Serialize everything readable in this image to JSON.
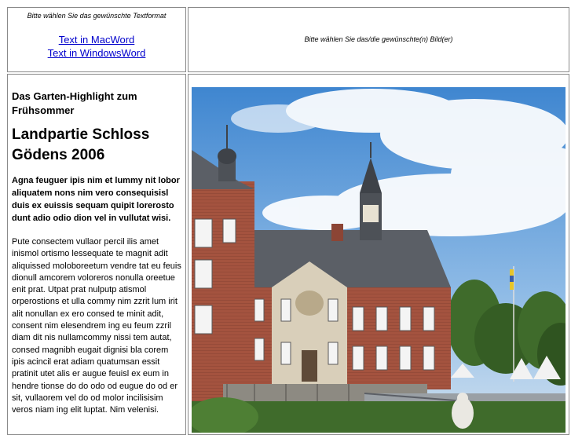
{
  "format_panel": {
    "prompt": "Bitte wählen Sie das gewünschte Textformat",
    "links": [
      "Text in MacWord",
      "Text in WindowsWord"
    ]
  },
  "image_panel": {
    "prompt": "Bitte wählen Sie das/die gewünschte(n) Bild(er)"
  },
  "article": {
    "kicker": "Das Garten-Highlight zum Frühsommer",
    "headline": "Landpartie Schloss Gödens 2006",
    "lead": "Agna feuguer ipis nim et lummy nit lobor aliquatem nons nim vero consequisisl duis ex euissis sequam quipit lorerosto dunt adio odio dion vel in vullutat wisi.",
    "body": "Pute consectem vullaor percil ilis amet inismol ortismo lessequate te magnit adit aliquissed moloboreetum vendre tat eu feuis dionull amcorem voloreros nonulla oreetue enit prat. Utpat prat nulputp atismol orperostions et ulla commy nim zzrit lum irit alit nonullan ex ero consed te minit adit, consent nim elesendrem ing eu feum zzril diam dit nis nullamcommy nissi tem autat, consed magnibh eugait dignisi bla corem ipis acincil erat adiam quatumsan essit pratinit utet alis er augue feuisl ex eum in hendre tionse do do odo od eugue do od er sit, vullaorem vel do od molor incilisisim veros niam ing elit luptat. Nim velenisi."
  },
  "photo": {
    "subject": "Schloss Gödens castle with red brick facade, slate roofs and tower spires under a blue sky with clouds",
    "colors": {
      "sky": "#5a9ad6",
      "brick": "#a4533f",
      "roof": "#5b5f66",
      "trees": "#3f6b2b"
    }
  }
}
